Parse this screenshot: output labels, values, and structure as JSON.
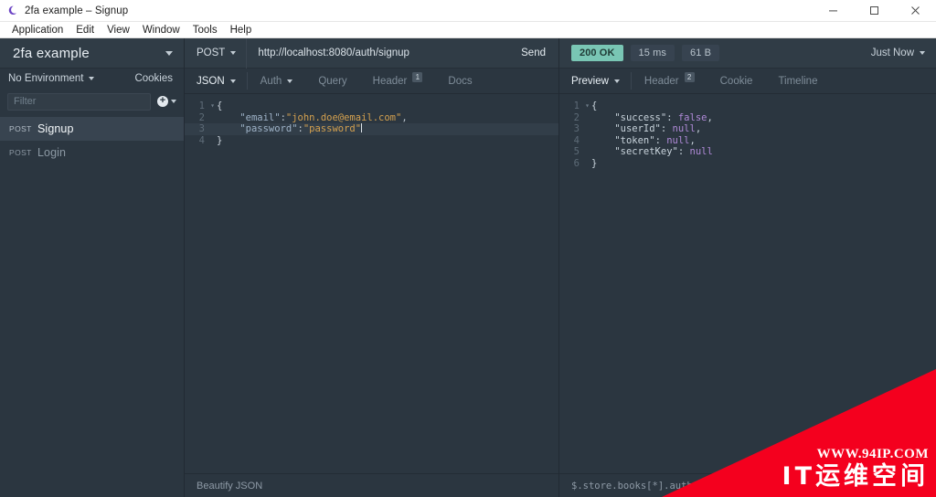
{
  "window": {
    "title": "2fa example – Signup",
    "logo_icon": "app-logo-icon",
    "minimize_label": "–",
    "maximize_label": "□",
    "close_label": "✕"
  },
  "menubar": {
    "items": [
      {
        "label": "Application"
      },
      {
        "label": "Edit"
      },
      {
        "label": "View"
      },
      {
        "label": "Window"
      },
      {
        "label": "Tools"
      },
      {
        "label": "Help"
      }
    ]
  },
  "sidebar": {
    "workspace_name": "2fa example",
    "environment": "No Environment",
    "cookies_label": "Cookies",
    "filter_placeholder": "Filter",
    "filter_value": "",
    "add_label": "+",
    "requests": [
      {
        "method": "POST",
        "name": "Signup",
        "active": true
      },
      {
        "method": "POST",
        "name": "Login",
        "active": false
      }
    ]
  },
  "request": {
    "method": "POST",
    "url": "http://localhost:8080/auth/signup",
    "send_label": "Send",
    "tabs": [
      {
        "label": "JSON",
        "dropdown": true,
        "primary": true,
        "badge": ""
      },
      {
        "label": "Auth",
        "dropdown": true,
        "primary": false,
        "badge": ""
      },
      {
        "label": "Query",
        "dropdown": false,
        "primary": false,
        "badge": ""
      },
      {
        "label": "Header",
        "dropdown": false,
        "primary": false,
        "badge": "1"
      },
      {
        "label": "Docs",
        "dropdown": false,
        "primary": false,
        "badge": ""
      }
    ],
    "body_lines": [
      {
        "num": "1",
        "fold": "▾",
        "segments": [
          {
            "t": "{",
            "c": "k-brace"
          }
        ],
        "highlight": false
      },
      {
        "num": "2",
        "fold": "",
        "segments": [
          {
            "t": "    ",
            "c": "k-punct"
          },
          {
            "t": "\"email\"",
            "c": "k-key"
          },
          {
            "t": ":",
            "c": "k-punct"
          },
          {
            "t": "\"john.doe@email.com\"",
            "c": "k-str"
          },
          {
            "t": ",",
            "c": "k-punct"
          }
        ],
        "highlight": false
      },
      {
        "num": "3",
        "fold": "",
        "segments": [
          {
            "t": "    ",
            "c": "k-punct"
          },
          {
            "t": "\"password\"",
            "c": "k-key"
          },
          {
            "t": ":",
            "c": "k-punct"
          },
          {
            "t": "\"password\"",
            "c": "k-str"
          }
        ],
        "highlight": true
      },
      {
        "num": "4",
        "fold": "",
        "segments": [
          {
            "t": "}",
            "c": "k-brace"
          }
        ],
        "highlight": false
      }
    ],
    "footer_label": "Beautify JSON"
  },
  "response": {
    "status": "200 OK",
    "time": "15 ms",
    "size": "61 B",
    "timestamp": "Just Now",
    "tabs": [
      {
        "label": "Preview",
        "dropdown": true,
        "primary": true,
        "badge": ""
      },
      {
        "label": "Header",
        "dropdown": false,
        "primary": false,
        "badge": "2"
      },
      {
        "label": "Cookie",
        "dropdown": false,
        "primary": false,
        "badge": ""
      },
      {
        "label": "Timeline",
        "dropdown": false,
        "primary": false,
        "badge": ""
      }
    ],
    "body_lines": [
      {
        "num": "1",
        "fold": "▾",
        "segments": [
          {
            "t": "{",
            "c": "r-key"
          }
        ],
        "highlight": false
      },
      {
        "num": "2",
        "fold": "",
        "segments": [
          {
            "t": "    ",
            "c": "r-key"
          },
          {
            "t": "\"success\"",
            "c": "r-key"
          },
          {
            "t": ": ",
            "c": "r-key"
          },
          {
            "t": "false",
            "c": "r-val"
          },
          {
            "t": ",",
            "c": "r-key"
          }
        ],
        "highlight": false
      },
      {
        "num": "3",
        "fold": "",
        "segments": [
          {
            "t": "    ",
            "c": "r-key"
          },
          {
            "t": "\"userId\"",
            "c": "r-key"
          },
          {
            "t": ": ",
            "c": "r-key"
          },
          {
            "t": "null",
            "c": "r-val"
          },
          {
            "t": ",",
            "c": "r-key"
          }
        ],
        "highlight": false
      },
      {
        "num": "4",
        "fold": "",
        "segments": [
          {
            "t": "    ",
            "c": "r-key"
          },
          {
            "t": "\"token\"",
            "c": "r-key"
          },
          {
            "t": ": ",
            "c": "r-key"
          },
          {
            "t": "null",
            "c": "r-val"
          },
          {
            "t": ",",
            "c": "r-key"
          }
        ],
        "highlight": false
      },
      {
        "num": "5",
        "fold": "",
        "segments": [
          {
            "t": "    ",
            "c": "r-key"
          },
          {
            "t": "\"secretKey\"",
            "c": "r-key"
          },
          {
            "t": ": ",
            "c": "r-key"
          },
          {
            "t": "null",
            "c": "r-val"
          }
        ],
        "highlight": false
      },
      {
        "num": "6",
        "fold": "",
        "segments": [
          {
            "t": "}",
            "c": "r-key"
          }
        ],
        "highlight": false
      }
    ],
    "footer_label": "$.store.books[*].author"
  },
  "watermark": {
    "url": "WWW.94IP.COM",
    "name": "IT运维空间",
    "color": "#f4001e"
  },
  "colors": {
    "bg": "#2b3640",
    "panel": "#303c46",
    "accent_ok": "#79c6b4",
    "string": "#d3a04f",
    "value": "#b08ad8"
  }
}
